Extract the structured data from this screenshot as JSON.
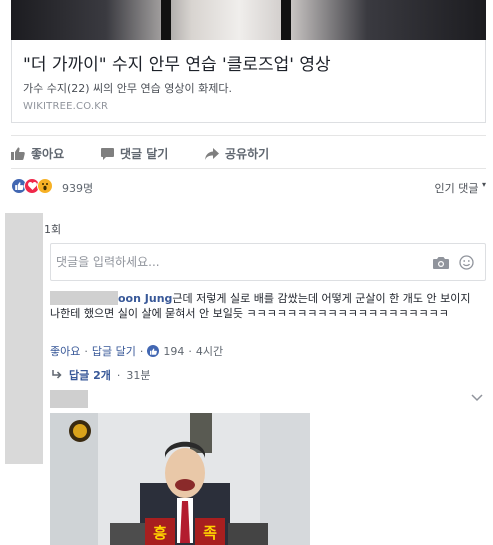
{
  "card": {
    "title": "\"더 가까이\" 수지 안무 연습 '클로즈업' 영상",
    "description": "가수 수지(22) 씨의 안무 연습 영상이 화제다.",
    "domain": "WIKITREE.CO.KR"
  },
  "actions": {
    "like": "좋아요",
    "comment": "댓글 달기",
    "share": "공유하기"
  },
  "reactions": {
    "count": "939명",
    "sort_label": "인기 댓글"
  },
  "comments_section": {
    "count_text": "1회",
    "input_placeholder": "댓글을 입력하세요...",
    "comment": {
      "author_visible": "oon Jung",
      "text": "근데 저렇게 실로 배를 감쌌는데 어떻게 군살이 한 개도 안 보이지 나한테 했으면 실이 살에 묻혀서 안 보일듯 ㅋㅋㅋㅋㅋㅋㅋㅋㅋㅋㅋㅋㅋㅋㅋㅋㅋㅋㅋㅋ",
      "like_label": "좋아요",
      "reply_label": "답글 달기",
      "like_count": "194",
      "time": "4시간"
    },
    "replies": {
      "label": "답글 2개",
      "time": "31분"
    },
    "meme_caption_1": "흥",
    "meme_caption_2": "족"
  },
  "colors": {
    "link_blue": "#385898",
    "like_blue": "#4267b2",
    "love_red": "#f0284a",
    "wow_yellow": "#f7b125"
  }
}
